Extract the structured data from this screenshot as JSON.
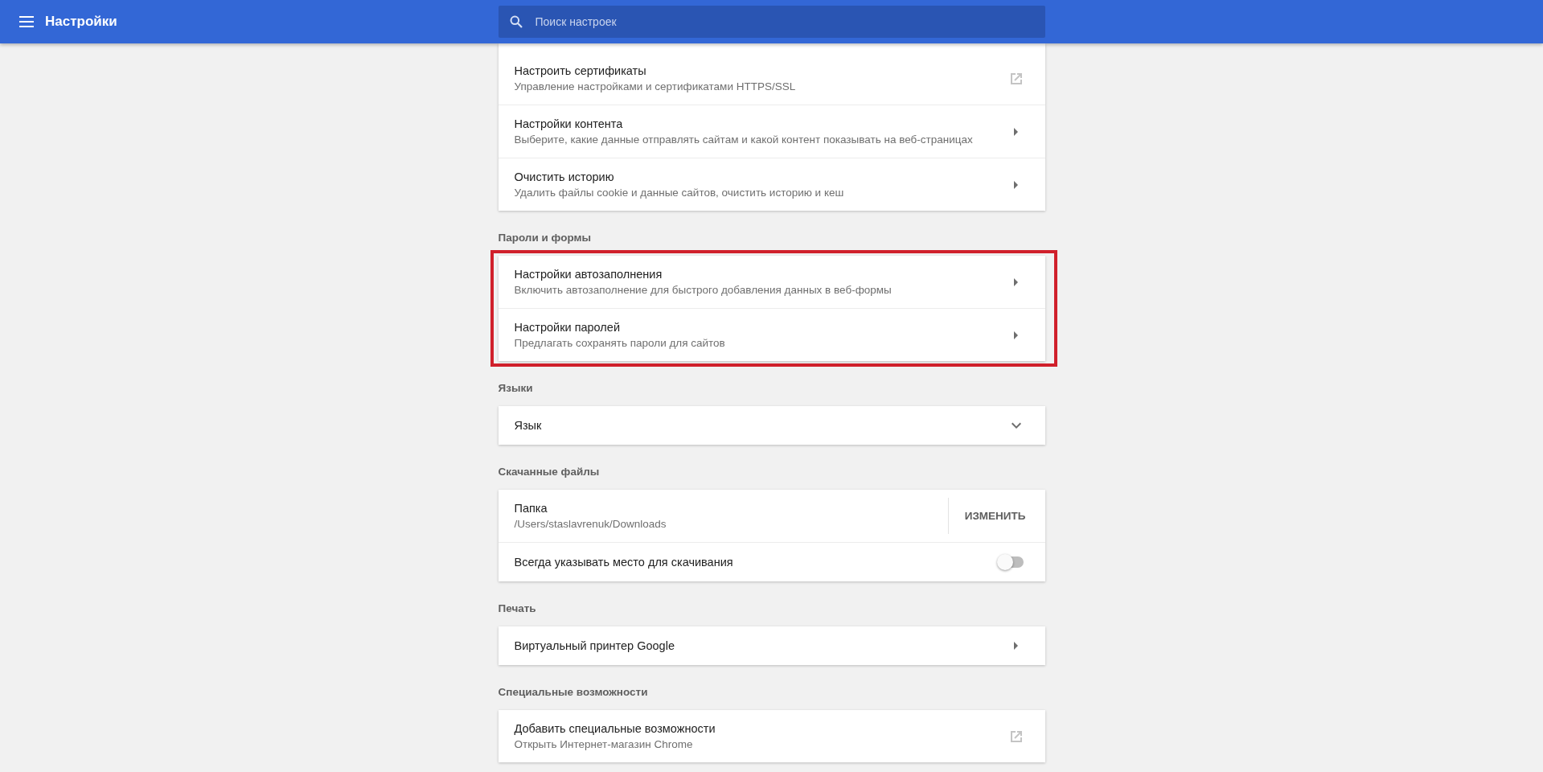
{
  "header": {
    "title": "Настройки",
    "search": {
      "placeholder": "Поиск настроек"
    }
  },
  "sections": [
    {
      "highlighted": false,
      "rows": [
        {
          "kind": "external",
          "title": "Настроить сертификаты",
          "subtitle": "Управление настройками и сертификатами HTTPS/SSL"
        },
        {
          "kind": "arrow",
          "title": "Настройки контента",
          "subtitle": "Выберите, какие данные отправлять сайтам и какой контент показывать на веб-страницах"
        },
        {
          "kind": "arrow",
          "title": "Очистить историю",
          "subtitle": "Удалить файлы cookie и данные сайтов, очистить историю и кеш"
        }
      ]
    },
    {
      "heading": "Пароли и формы",
      "highlighted": true,
      "rows": [
        {
          "kind": "arrow",
          "title": "Настройки автозаполнения",
          "subtitle": "Включить автозаполнение для быстрого добавления данных в веб-формы"
        },
        {
          "kind": "arrow",
          "title": "Настройки паролей",
          "subtitle": "Предлагать сохранять пароли для сайтов"
        }
      ]
    },
    {
      "heading": "Языки",
      "highlighted": false,
      "rows": [
        {
          "kind": "expand",
          "title": "Язык"
        }
      ]
    },
    {
      "heading": "Скачанные файлы",
      "highlighted": false,
      "rows": [
        {
          "kind": "action",
          "title": "Папка",
          "subtitle": "/Users/staslavrenuk/Downloads",
          "button": "ИЗМЕНИТЬ"
        },
        {
          "kind": "toggle",
          "title": "Всегда указывать место для скачивания",
          "on": false
        }
      ]
    },
    {
      "heading": "Печать",
      "highlighted": false,
      "rows": [
        {
          "kind": "arrow",
          "title": "Виртуальный принтер Google"
        }
      ]
    },
    {
      "heading": "Специальные возможности",
      "highlighted": false,
      "rows": [
        {
          "kind": "external",
          "title": "Добавить специальные возможности",
          "subtitle": "Открыть Интернет-магазин Chrome"
        }
      ]
    }
  ]
}
